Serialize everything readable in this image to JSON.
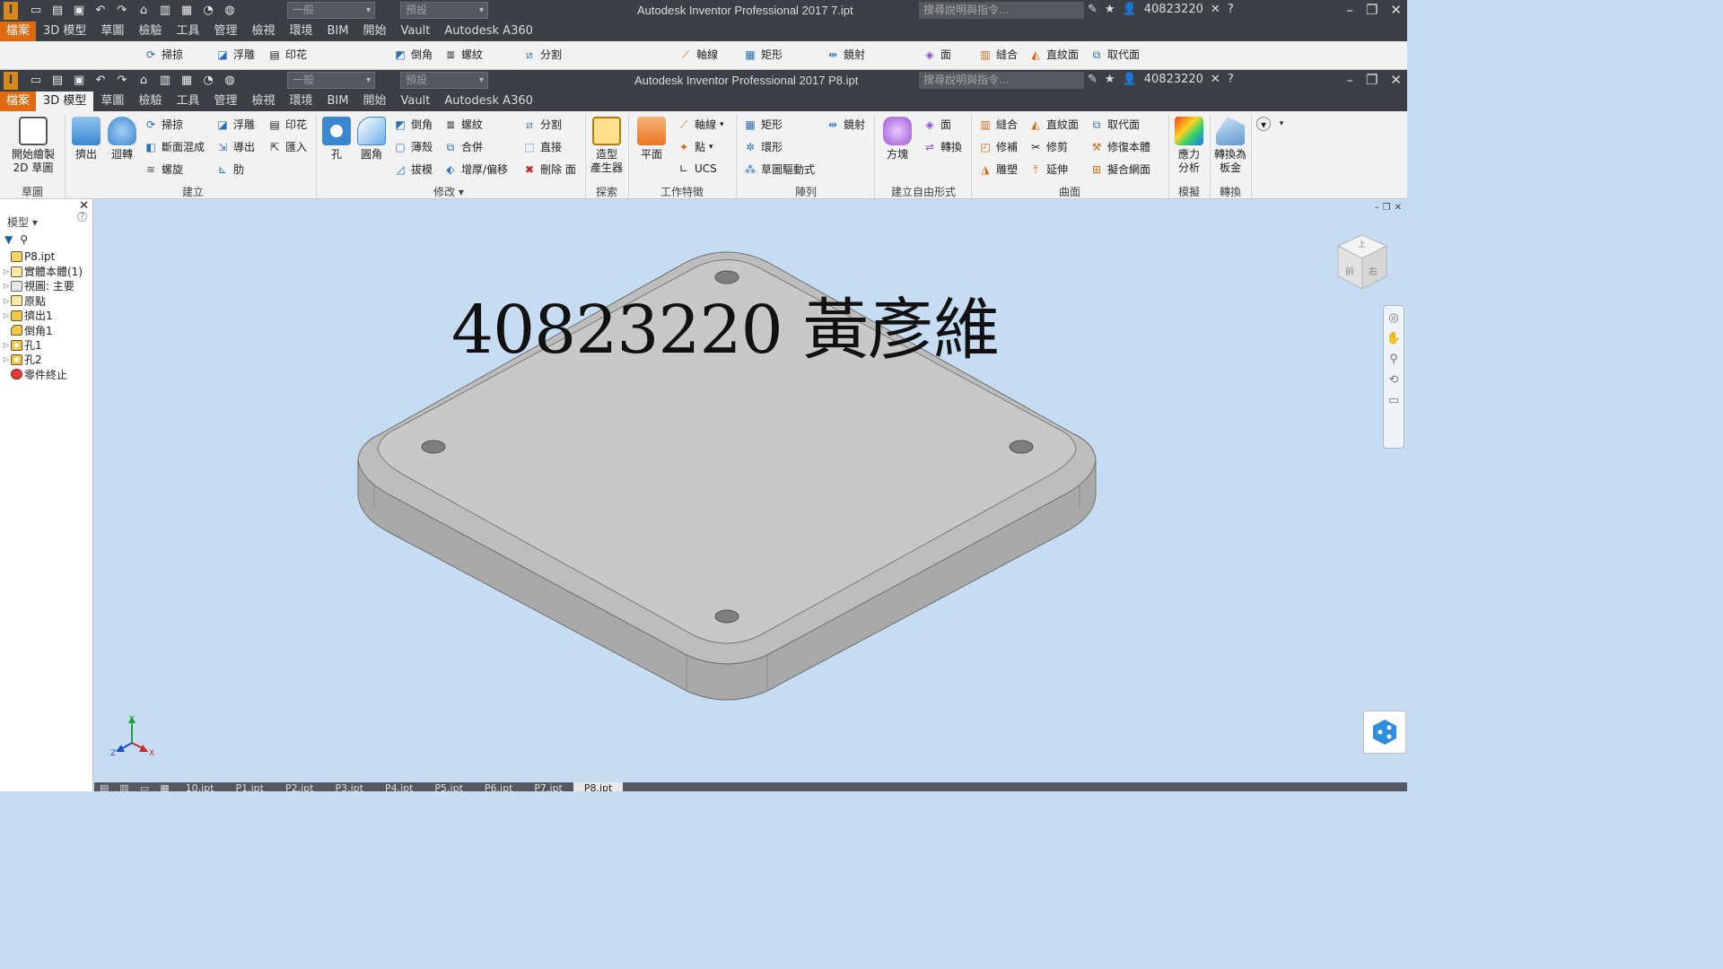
{
  "titlebar1": {
    "style_value": "一般",
    "material_value": "預設",
    "app_title": "Autodesk Inventor Professional 2017    7.ipt",
    "search_placeholder": "搜尋說明與指令...",
    "user": "40823220"
  },
  "titlebar2": {
    "style_value": "一般",
    "material_value": "預設",
    "app_title": "Autodesk Inventor Professional 2017    P8.ipt",
    "search_placeholder": "搜尋說明與指令...",
    "user": "40823220"
  },
  "menu_tabs": [
    "檔案",
    "3D 模型",
    "草圖",
    "檢驗",
    "工具",
    "管理",
    "檢視",
    "環境",
    "BIM",
    "開始",
    "Vault",
    "Autodesk A360"
  ],
  "ribbon_top_partial": {
    "sweep": "掃掠",
    "emboss": "浮雕",
    "decal": "印花",
    "chamfer": "倒角",
    "coil": "螺紋",
    "split": "分割",
    "axis": "軸線",
    "rect": "矩形",
    "mirror": "鏡射",
    "face": "面",
    "stitch": "縫合",
    "ruled": "直紋面",
    "replace": "取代面"
  },
  "ribbon": {
    "sketch": {
      "start_sketch": "開始繪製\n2D 草圖",
      "panel": "草圖"
    },
    "create": {
      "extrude": "擠出",
      "revolve": "迴轉",
      "sweep": "掃掠",
      "loft": "斷面混成",
      "coil": "螺旋",
      "emboss": "浮雕",
      "derive": "導出",
      "rib": "肋",
      "decal": "印花",
      "import": "匯入",
      "panel": "建立"
    },
    "modify": {
      "hole": "孔",
      "fillet": "圓角",
      "chamfer": "倒角",
      "shell": "薄殼",
      "draft": "拔模",
      "thread": "螺紋",
      "combine": "合併",
      "thicken": "增厚/偏移",
      "split": "分割",
      "direct": "直接",
      "delete_face": "刪除 面",
      "panel": "修改"
    },
    "explore": {
      "shape_generator": "造型\n產生器",
      "panel": "探索"
    },
    "work_features": {
      "plane": "平面",
      "axis": "軸線",
      "point": "點",
      "ucs": "UCS",
      "panel": "工作特徵"
    },
    "pattern": {
      "rectangular": "矩形",
      "circular": "環形",
      "sketch_driven": "草圖驅動式",
      "mirror": "鏡射",
      "panel": "陣列"
    },
    "freeform": {
      "box": "方塊",
      "face": "面",
      "convert": "轉換",
      "panel": "建立自由形式"
    },
    "surface": {
      "stitch": "縫合",
      "patch": "修補",
      "sculpt": "雕塑",
      "ruled": "直紋面",
      "trim": "修剪",
      "extend": "延伸",
      "replace_face": "取代面",
      "repair_bodies": "修復本體",
      "fit_mesh": "擬合網面",
      "panel": "曲面"
    },
    "simulation": {
      "stress": "應力\n分析",
      "panel": "模擬"
    },
    "convert": {
      "sheet_metal": "轉換為\n板金",
      "panel": "轉換"
    }
  },
  "browser": {
    "title": "模型",
    "items": [
      {
        "label": "P8.ipt",
        "expand": ""
      },
      {
        "label": "實體本體(1)",
        "expand": "▷"
      },
      {
        "label": "視圖: 主要",
        "expand": "▷"
      },
      {
        "label": "原點",
        "expand": "▷"
      },
      {
        "label": "擠出1",
        "expand": "▷"
      },
      {
        "label": "倒角1",
        "expand": ""
      },
      {
        "label": "孔1",
        "expand": "▷"
      },
      {
        "label": "孔2",
        "expand": "▷"
      },
      {
        "label": "零件終止",
        "expand": ""
      }
    ]
  },
  "viewport": {
    "overlay_text": "40823220 黃彥維",
    "viewcube_top": "上",
    "viewcube_front": "前",
    "viewcube_right": "右",
    "axis_x": "X",
    "axis_y": "Y",
    "axis_z": "Z"
  },
  "doc_tabs": [
    "10.ipt",
    "P1.ipt",
    "P2.ipt",
    "P3.ipt",
    "P4.ipt",
    "P5.ipt",
    "P6.ipt",
    "P7.ipt",
    "P8.ipt"
  ],
  "colors": {
    "file_tab": "#e06a10",
    "viewport_bg": "#c5dcf2",
    "plate": "#c8c8c8"
  }
}
